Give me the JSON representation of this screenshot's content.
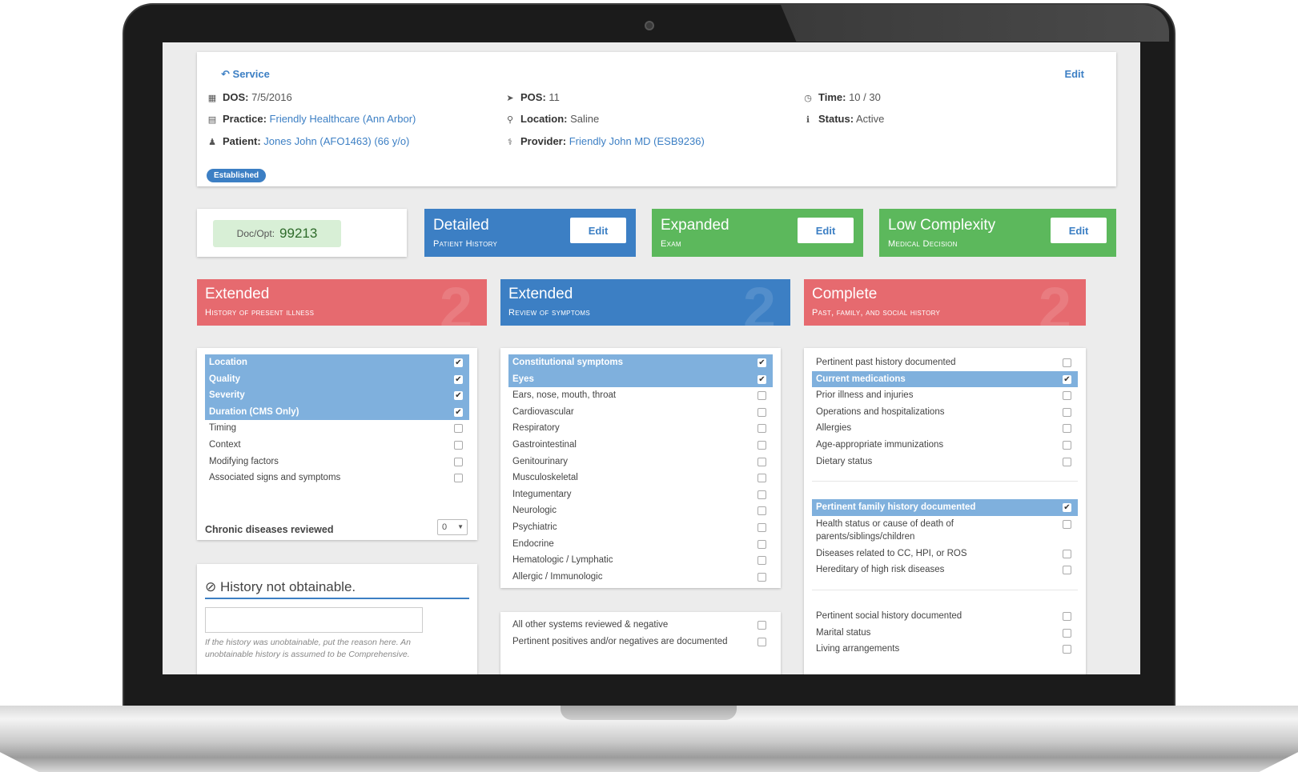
{
  "service": {
    "back_label": "Service",
    "edit_label": "Edit",
    "dos_label": "DOS:",
    "dos_value": "7/5/2016",
    "pos_label": "POS:",
    "pos_value": "11",
    "time_label": "Time:",
    "time_value": "10 / 30",
    "practice_label": "Practice:",
    "practice_value": "Friendly Healthcare (Ann Arbor)",
    "location_label": "Location:",
    "location_value": "Saline",
    "status_label": "Status:",
    "status_value": "Active",
    "patient_label": "Patient:",
    "patient_value": "Jones John (AFO1463) (66 y/o)",
    "provider_label": "Provider:",
    "provider_value": "Friendly John MD (ESB9236)",
    "badge": "Established"
  },
  "summary": {
    "docopt_label": "Doc/Opt:",
    "docopt_value": "99213",
    "cards": [
      {
        "level": "Detailed",
        "subtitle": "Patient History",
        "edit": "Edit",
        "color": "#3c7fc4"
      },
      {
        "level": "Expanded",
        "subtitle": "Exam",
        "edit": "Edit",
        "color": "#5cb85c"
      },
      {
        "level": "Low Complexity",
        "subtitle": "Medical Decision",
        "edit": "Edit",
        "color": "#5cb85c"
      }
    ]
  },
  "categories": [
    {
      "level": "Extended",
      "subtitle": "History of present illness",
      "color": "#e66a6f"
    },
    {
      "level": "Extended",
      "subtitle": "Review of symptoms",
      "color": "#3c7fc4"
    },
    {
      "level": "Complete",
      "subtitle": "Past, family, and social history",
      "color": "#e66a6f"
    }
  ],
  "hpi": {
    "items": [
      {
        "label": "Location",
        "checked": true
      },
      {
        "label": "Quality",
        "checked": true
      },
      {
        "label": "Severity",
        "checked": true
      },
      {
        "label": "Duration (CMS Only)",
        "checked": true
      },
      {
        "label": "Timing",
        "checked": false
      },
      {
        "label": "Context",
        "checked": false
      },
      {
        "label": "Modifying factors",
        "checked": false
      },
      {
        "label": "Associated signs and symptoms",
        "checked": false
      }
    ],
    "chronic_label": "Chronic diseases reviewed",
    "chronic_value": "0"
  },
  "history_not_obtainable": {
    "title": "History not obtainable.",
    "help": "If the history was unobtainable, put the reason here. An unobtainable history is assumed to be Comprehensive."
  },
  "ros": {
    "items": [
      {
        "label": "Constitutional symptoms",
        "checked": true
      },
      {
        "label": "Eyes",
        "checked": true
      },
      {
        "label": "Ears, nose, mouth, throat",
        "checked": false
      },
      {
        "label": "Cardiovascular",
        "checked": false
      },
      {
        "label": "Respiratory",
        "checked": false
      },
      {
        "label": "Gastrointestinal",
        "checked": false
      },
      {
        "label": "Genitourinary",
        "checked": false
      },
      {
        "label": "Musculoskeletal",
        "checked": false
      },
      {
        "label": "Integumentary",
        "checked": false
      },
      {
        "label": "Neurologic",
        "checked": false
      },
      {
        "label": "Psychiatric",
        "checked": false
      },
      {
        "label": "Endocrine",
        "checked": false
      },
      {
        "label": "Hematologic / Lymphatic",
        "checked": false
      },
      {
        "label": "Allergic / Immunologic",
        "checked": false
      }
    ],
    "extra": [
      {
        "label": "All other systems reviewed & negative",
        "checked": false
      },
      {
        "label": "Pertinent positives and/or negatives are documented",
        "checked": false
      }
    ]
  },
  "pfsh": {
    "past": [
      {
        "label": "Pertinent past history documented",
        "checked": false
      },
      {
        "label": "Current medications",
        "checked": true
      },
      {
        "label": "Prior illness and injuries",
        "checked": false
      },
      {
        "label": "Operations and hospitalizations",
        "checked": false
      },
      {
        "label": "Allergies",
        "checked": false
      },
      {
        "label": "Age-appropriate immunizations",
        "checked": false
      },
      {
        "label": "Dietary status",
        "checked": false
      }
    ],
    "family": [
      {
        "label": "Pertinent family history documented",
        "checked": true
      },
      {
        "label": "Health status or cause of death of parents/siblings/children",
        "checked": false,
        "tall": true
      },
      {
        "label": "Diseases related to CC, HPI, or ROS",
        "checked": false
      },
      {
        "label": "Hereditary of high risk diseases",
        "checked": false
      }
    ],
    "social": [
      {
        "label": "Pertinent social history documented",
        "checked": false
      },
      {
        "label": "Marital status",
        "checked": false
      },
      {
        "label": "Living arrangements",
        "checked": false
      }
    ]
  },
  "icons": {
    "back": "↶",
    "calendar": "▦",
    "location_arrow": "➤",
    "clock": "◷",
    "building": "▤",
    "map_pin": "⚲",
    "info": "ℹ",
    "person": "♟",
    "stethoscope": "⚕",
    "ban": "⊘",
    "check": "✔"
  }
}
